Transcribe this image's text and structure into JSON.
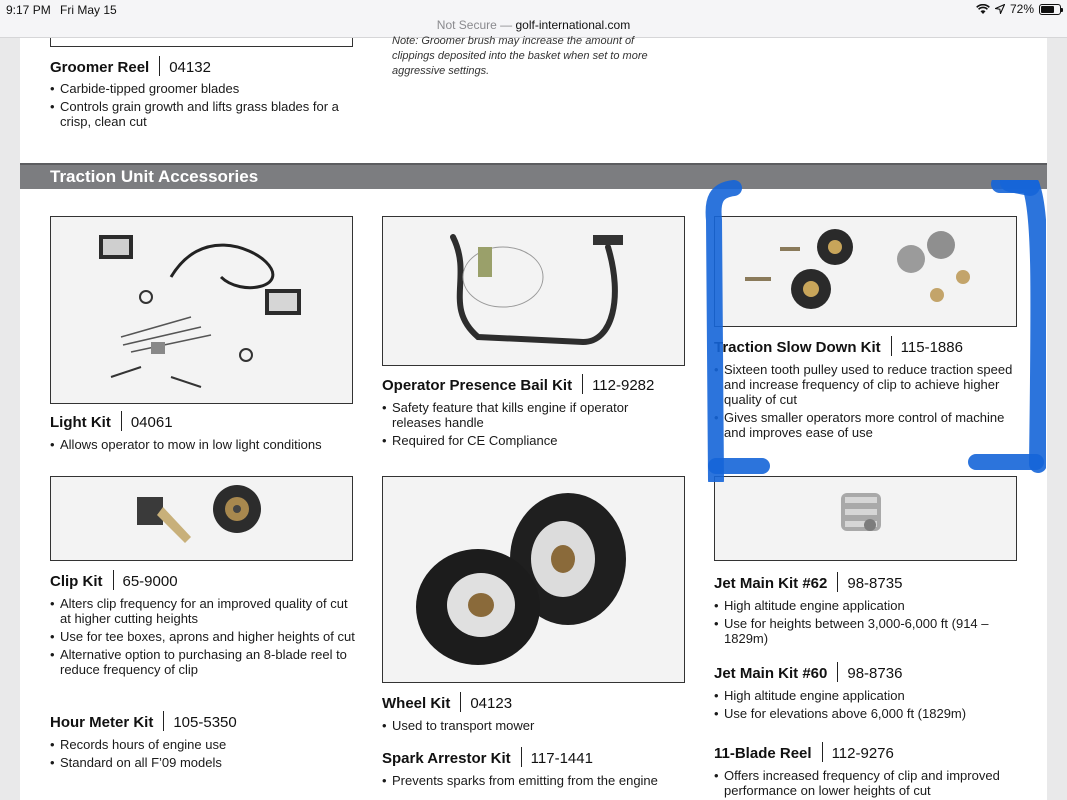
{
  "status": {
    "time": "9:17 PM",
    "date": "Fri May 15",
    "battery": "72%"
  },
  "address": {
    "security": "Not Secure",
    "separator": " — ",
    "domain": "golf-international.com"
  },
  "top": {
    "groomer": {
      "name": "Groomer Reel",
      "code": "04132",
      "bullets": [
        "Carbide-tipped groomer blades",
        "Controls grain growth and lifts grass blades for a crisp, clean cut"
      ]
    },
    "note": "Note: Groomer brush may increase the amount of clippings deposited into the basket when set to more aggressive settings."
  },
  "section_title": "Traction Unit Accessories",
  "products": {
    "light_kit": {
      "name": "Light Kit",
      "code": "04061",
      "bullets": [
        "Allows operator to mow in low light conditions"
      ]
    },
    "bail_kit": {
      "name": "Operator Presence Bail Kit",
      "code": "112-9282",
      "bullets": [
        "Safety feature that kills engine if operator releases handle",
        "Required for CE Compliance"
      ]
    },
    "slowdown_kit": {
      "name": "Traction Slow Down Kit",
      "code": "115-1886",
      "bullets": [
        "Sixteen tooth pulley used to reduce traction speed and increase frequency of clip to achieve higher quality of cut",
        "Gives smaller operators more control of machine and improves ease of use"
      ]
    },
    "clip_kit": {
      "name": "Clip Kit",
      "code": "65-9000",
      "bullets": [
        "Alters clip frequency for an improved quality of cut at higher cutting heights",
        "Use for tee boxes, aprons and higher heights of cut",
        "Alternative option to purchasing an 8-blade reel to reduce frequency of clip"
      ]
    },
    "hour_meter": {
      "name": "Hour Meter Kit",
      "code": "105-5350",
      "bullets": [
        "Records hours of engine use",
        "Standard on all F’09 models"
      ]
    },
    "wheel_kit": {
      "name": "Wheel Kit",
      "code": "04123",
      "bullets": [
        "Used to transport mower"
      ]
    },
    "spark_arrestor": {
      "name": "Spark Arrestor Kit",
      "code": "117-1441",
      "bullets": [
        "Prevents sparks from emitting from the engine"
      ]
    },
    "jet62": {
      "name": "Jet Main Kit #62",
      "code": "98-8735",
      "bullets": [
        "High altitude engine application",
        "Use for heights between 3,000-6,000 ft (914 – 1829m)"
      ]
    },
    "jet60": {
      "name": "Jet Main Kit #60",
      "code": "98-8736",
      "bullets": [
        "High altitude engine application",
        "Use for elevations above 6,000 ft (1829m)"
      ]
    },
    "blade_reel": {
      "name": "11-Blade Reel",
      "code": "112-9276",
      "bullets": [
        "Offers increased frequency of clip and improved performance on lower heights of cut"
      ]
    }
  },
  "colors": {
    "band": "#7c7d80",
    "highlight": "#1565d8"
  }
}
